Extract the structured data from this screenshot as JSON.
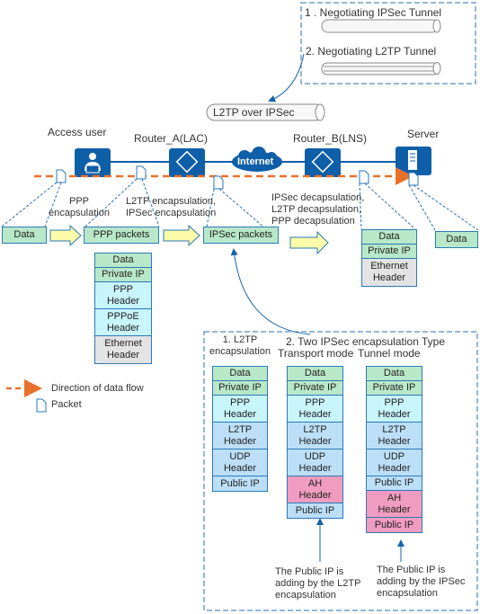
{
  "negotiation_box": {
    "step1": "1 . Negotiating IPSec Tunnel",
    "step2": "2. Negotiating L2TP Tunnel"
  },
  "tunnel_label": "L2TP over IPSec",
  "nodes": {
    "access_user": "Access user",
    "router_a": "Router_A(LAC)",
    "internet": "Internet",
    "router_b": "Router_B(LNS)",
    "server": "Server"
  },
  "steps": {
    "ppp_encap": [
      "PPP",
      "encapsulation"
    ],
    "l2tp_ipsec_encap": [
      "L2TP encapsulation,",
      "IPSec encapsulation"
    ],
    "decap": [
      "IPSec decapsulation,",
      "L2TP decapsulation,",
      "PPP decapsulation"
    ]
  },
  "packets": {
    "data": "Data",
    "ppp_packets": "PPP packets",
    "ipsec_packets": "IPSec packets",
    "server_data": "Data"
  },
  "stacks": {
    "pppoe": [
      {
        "label": "Data",
        "color": "green"
      },
      {
        "label": "Private IP",
        "color": "green"
      },
      {
        "label": "PPP Header",
        "color": "cyan"
      },
      {
        "label": "PPPoE Header",
        "color": "cyan"
      },
      {
        "label": "Ethernet Header",
        "color": "grey"
      }
    ],
    "lns_out": [
      {
        "label": "Data",
        "color": "green"
      },
      {
        "label": "Private IP",
        "color": "green"
      },
      {
        "label": "Ethernet Header",
        "color": "grey"
      }
    ],
    "l2tp": [
      {
        "label": "Data",
        "color": "green"
      },
      {
        "label": "Private IP",
        "color": "green"
      },
      {
        "label": "PPP Header",
        "color": "cyan"
      },
      {
        "label": "L2TP Header",
        "color": "blue"
      },
      {
        "label": "UDP Header",
        "color": "blue"
      },
      {
        "label": "Public IP",
        "color": "blue"
      }
    ],
    "transport": [
      {
        "label": "Data",
        "color": "green"
      },
      {
        "label": "Private IP",
        "color": "green"
      },
      {
        "label": "PPP Header",
        "color": "cyan"
      },
      {
        "label": "L2TP Header",
        "color": "blue"
      },
      {
        "label": "UDP Header",
        "color": "blue"
      },
      {
        "label": "AH Header",
        "color": "pink"
      },
      {
        "label": "Public IP",
        "color": "blue"
      }
    ],
    "tunnel": [
      {
        "label": "Data",
        "color": "green"
      },
      {
        "label": "Private IP",
        "color": "green"
      },
      {
        "label": "PPP Header",
        "color": "cyan"
      },
      {
        "label": "L2TP Header",
        "color": "blue"
      },
      {
        "label": "UDP Header",
        "color": "blue"
      },
      {
        "label": "Public IP",
        "color": "blue"
      },
      {
        "label": "AH Header",
        "color": "pink"
      },
      {
        "label": "Public IP",
        "color": "pink"
      }
    ]
  },
  "encap_box": {
    "l2tp_title": [
      "1. L2TP",
      "encapsulation"
    ],
    "ipsec_title": "2. Two IPSec encapsulation Type",
    "transport_mode": "Transport mode",
    "tunnel_mode": "Tunnel mode",
    "note_l2tp": [
      "The Public IP is",
      "adding by the L2TP",
      "encapsulation"
    ],
    "note_ipsec": [
      "The Public IP is",
      "adding by the IPSec",
      "encapsulation"
    ]
  },
  "legend": {
    "flow": "Direction of data flow",
    "packet": "Packet"
  },
  "colors": {
    "node_blue": "#0e5ea8",
    "flow_orange": "#e8712a",
    "dashed_blue": "#2a6fb0",
    "green": "#b9e8c9",
    "cyan": "#c8f4fb",
    "blue": "#bcdff7",
    "pink": "#f09cc0",
    "grey": "#e3e3e3",
    "arrow_yellow": "#fbfba8"
  }
}
